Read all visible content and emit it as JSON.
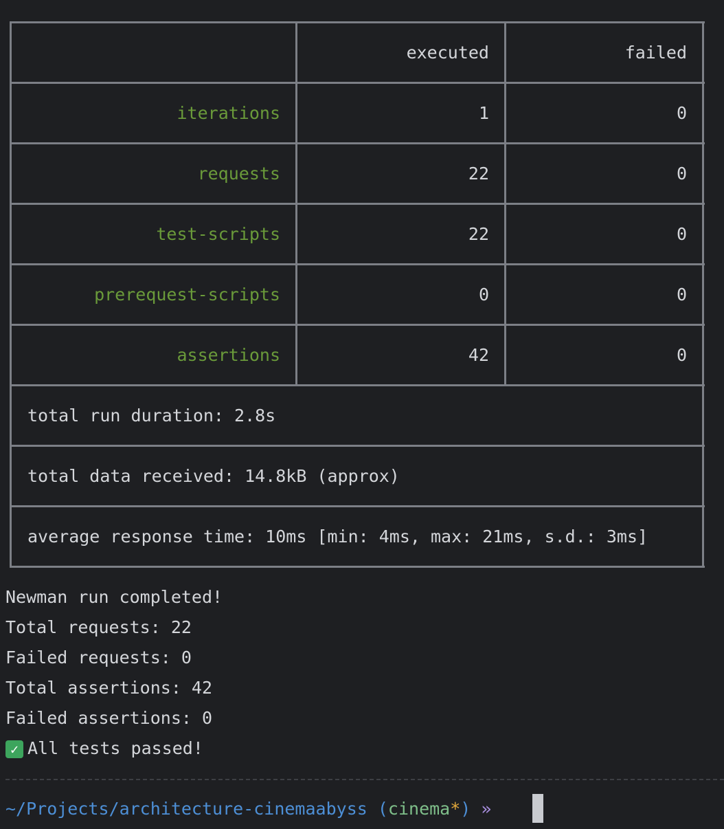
{
  "table": {
    "headers": {
      "executed": "executed",
      "failed": "failed"
    },
    "rows": [
      {
        "label": "iterations",
        "executed": "1",
        "failed": "0"
      },
      {
        "label": "requests",
        "executed": "22",
        "failed": "0"
      },
      {
        "label": "test-scripts",
        "executed": "22",
        "failed": "0"
      },
      {
        "label": "prerequest-scripts",
        "executed": "0",
        "failed": "0"
      },
      {
        "label": "assertions",
        "executed": "42",
        "failed": "0"
      }
    ],
    "summary": [
      "total run duration: 2.8s",
      "total data received: 14.8kB (approx)",
      "average response time: 10ms [min: 4ms, max: 21ms, s.d.: 3ms]"
    ]
  },
  "output": {
    "lines": [
      "Newman run completed!",
      "Total requests: 22",
      "Failed requests: 0",
      "Total assertions: 42",
      "Failed assertions: 0"
    ],
    "success_icon": "check-mark-icon",
    "success_text": "All tests passed!"
  },
  "prompt": {
    "path": "~/Projects/architecture-cinemaabyss",
    "paren_open": "(",
    "branch": "cinema",
    "dirty_marker": "*",
    "paren_close": ")",
    "arrow": "»"
  },
  "colors": {
    "background": "#1e1f22",
    "label_green": "#6a9a3a",
    "prompt_path": "#4d8fd6",
    "prompt_branch": "#7fbf8a",
    "dirty_marker": "#e2a83b"
  }
}
